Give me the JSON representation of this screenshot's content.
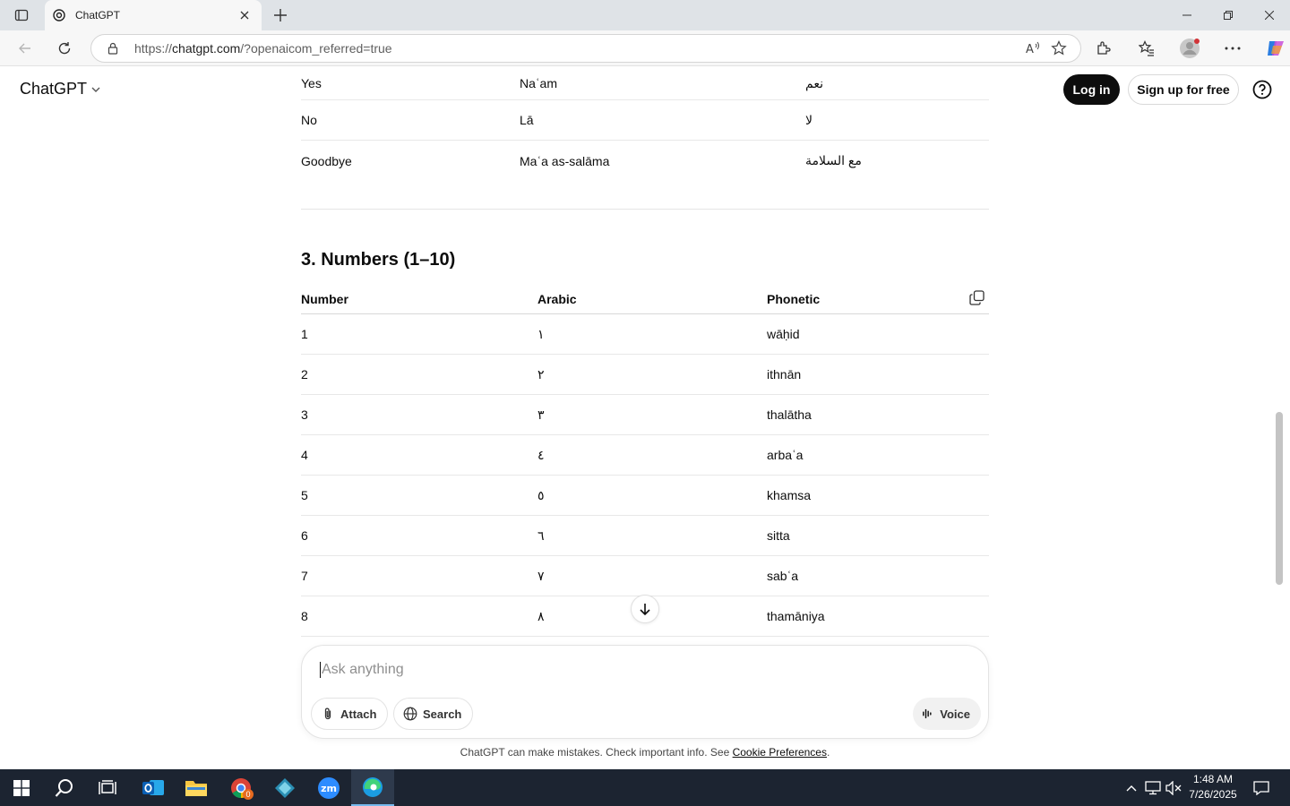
{
  "browser": {
    "tab_title": "ChatGPT",
    "url_prefix": "https://",
    "url_host": "chatgpt.com",
    "url_rest": "/?openaicom_referred=true"
  },
  "header": {
    "brand": "ChatGPT",
    "login": "Log in",
    "signup": "Sign up for free"
  },
  "table_phrases": {
    "rows": [
      {
        "english": "Yes",
        "translit": "Naʿam",
        "arabic": "نعم"
      },
      {
        "english": "No",
        "translit": "Lā",
        "arabic": "لا"
      },
      {
        "english": "Goodbye",
        "translit": "Maʿa as-salāma",
        "arabic": "مع السلامة"
      }
    ]
  },
  "section_numbers": {
    "title": "3. Numbers (1–10)",
    "headers": {
      "number": "Number",
      "arabic": "Arabic",
      "phonetic": "Phonetic"
    },
    "rows": [
      {
        "number": "1",
        "arabic": "١",
        "phonetic": "wāḥid"
      },
      {
        "number": "2",
        "arabic": "٢",
        "phonetic": "ithnān"
      },
      {
        "number": "3",
        "arabic": "٣",
        "phonetic": "thalātha"
      },
      {
        "number": "4",
        "arabic": "٤",
        "phonetic": "arbaʿa"
      },
      {
        "number": "5",
        "arabic": "٥",
        "phonetic": "khamsa"
      },
      {
        "number": "6",
        "arabic": "٦",
        "phonetic": "sitta"
      },
      {
        "number": "7",
        "arabic": "٧",
        "phonetic": "sabʿa"
      },
      {
        "number": "8",
        "arabic": "٨",
        "phonetic": "thamāniya"
      }
    ]
  },
  "composer": {
    "placeholder": "Ask anything",
    "attach": "Attach",
    "search": "Search",
    "voice": "Voice"
  },
  "footer": {
    "disclaimer": "ChatGPT can make mistakes. Check important info. See ",
    "cookie_link": "Cookie Preferences",
    "period": "."
  },
  "taskbar": {
    "time": "1:48 AM",
    "date": "7/26/2025",
    "chrome_badge": "0"
  }
}
